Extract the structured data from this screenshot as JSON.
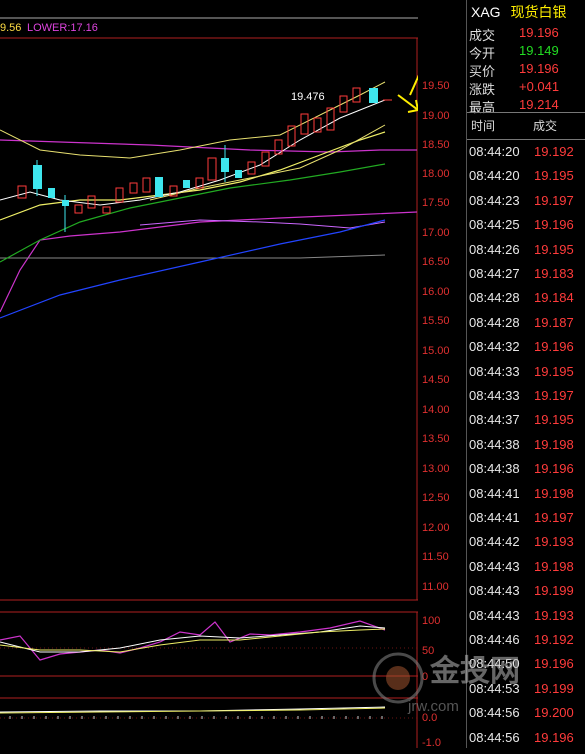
{
  "indicator": {
    "left_value": "9.56",
    "lower_label": "LOWER:17.16"
  },
  "price_axis": [
    "19.50",
    "19.00",
    "18.50",
    "18.00",
    "17.50",
    "17.00",
    "16.50",
    "16.00",
    "15.50",
    "15.00",
    "14.50",
    "14.00",
    "13.50",
    "13.00",
    "12.50",
    "12.00",
    "11.50",
    "11.00"
  ],
  "osc_axis": [
    "100",
    "50",
    "0"
  ],
  "osc2_axis": [
    "0.0",
    "-1.0"
  ],
  "peak_label": "19.476",
  "quote": {
    "symbol": "XAG",
    "name": "现货白银",
    "rows": [
      {
        "label": "成交",
        "value": "19.196",
        "color": "#ff3b3b"
      },
      {
        "label": "今开",
        "value": "19.149",
        "color": "#22dd22"
      },
      {
        "label": "买价",
        "value": "19.196",
        "color": "#ff3b3b"
      },
      {
        "label": "涨跌",
        "value": "+0.041",
        "color": "#ff3b3b"
      },
      {
        "label": "最高",
        "value": "19.214",
        "color": "#ff3b3b"
      }
    ]
  },
  "ticks": {
    "header_time": "时间",
    "header_price": "成交",
    "rows": [
      {
        "time": "08:44:20",
        "price": "19.192"
      },
      {
        "time": "08:44:20",
        "price": "19.195"
      },
      {
        "time": "08:44:23",
        "price": "19.197"
      },
      {
        "time": "08:44:25",
        "price": "19.196"
      },
      {
        "time": "08:44:26",
        "price": "19.195"
      },
      {
        "time": "08:44:27",
        "price": "19.183"
      },
      {
        "time": "08:44:28",
        "price": "19.184"
      },
      {
        "time": "08:44:28",
        "price": "19.187"
      },
      {
        "time": "08:44:32",
        "price": "19.196"
      },
      {
        "time": "08:44:33",
        "price": "19.195"
      },
      {
        "time": "08:44:33",
        "price": "19.197"
      },
      {
        "time": "08:44:37",
        "price": "19.195"
      },
      {
        "time": "08:44:38",
        "price": "19.198"
      },
      {
        "time": "08:44:38",
        "price": "19.196"
      },
      {
        "time": "08:44:41",
        "price": "19.198"
      },
      {
        "time": "08:44:41",
        "price": "19.197"
      },
      {
        "time": "08:44:42",
        "price": "19.193"
      },
      {
        "time": "08:44:43",
        "price": "19.198"
      },
      {
        "time": "08:44:43",
        "price": "19.199"
      },
      {
        "time": "08:44:43",
        "price": "19.193"
      },
      {
        "time": "08:44:46",
        "price": "19.192"
      },
      {
        "time": "08:44:50",
        "price": "19.196"
      },
      {
        "time": "08:44:53",
        "price": "19.199"
      },
      {
        "time": "08:44:56",
        "price": "19.200"
      },
      {
        "time": "08:44:56",
        "price": "19.196"
      }
    ]
  },
  "watermark": {
    "brand": "金投网",
    "url": "jrw.com"
  },
  "colors": {
    "up": "#ff3b3b",
    "down": "#3ee6ee",
    "accent": "#ffee00"
  }
}
